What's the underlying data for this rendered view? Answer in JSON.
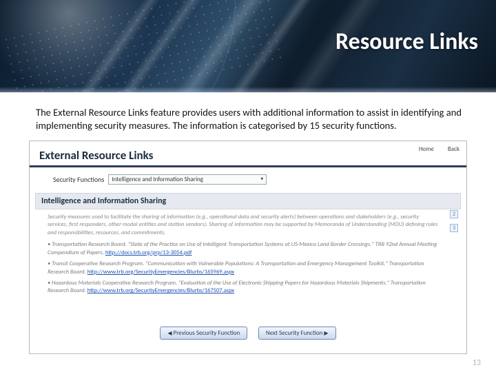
{
  "slide": {
    "title": "Resource Links",
    "intro": "The External Resource Links feature provides users with additional information to assist in identifying and implementing security measures.  The information is categorised by 15 security functions.",
    "pageNumber": "13"
  },
  "topnav": {
    "home": "Home",
    "back": "Back"
  },
  "panel": {
    "heading": "External Resource Links",
    "filterLabel": "Security Functions",
    "dropdownValue": "Intelligence and Information Sharing",
    "subheading": "Intelligence and Information Sharing",
    "descItalic": "Security measures used to facilitate the sharing of information (e.g., operational data and security alerts) between operations and stakeholders (e.g., security services, first responders, other modal entities and station vendors). Sharing of information may be supported by Memoranda of Understanding (MOU) defining roles and responsibilities, resources, and commitments.",
    "items": [
      {
        "text": "• Transportation Research Board. \"State of the Practice on Use of Intelligent Transportation Systems at US-Mexico Land Border Crossings.\" TRB 92nd Annual Meeting Compendium of Papers. ",
        "link": "http://docs.trb.org/prp/13-3054.pdf"
      },
      {
        "text": "• Transit Cooperative Research Program. \"Communication with Vulnerable Populations: A Transportation and Emergency Management Toolkit.\" Transportation Research Board. ",
        "link": "http://www.trb.org/SecurityEmergencies/Blurbs/165969.aspx"
      },
      {
        "text": "• Hazardous Materials Cooperative Research Program. \"Evaluation of the Use of Electronic Shipping Papers for Hazardous Materials Shipments.\" Transportation Research Board. ",
        "link": "http://www.trb.org/SecurityEmergencies/Blurbs/167507.aspx"
      }
    ],
    "sideTop": "2",
    "sideBottom": "3",
    "prevBtn": "Previous Security Function",
    "nextBtn": "Next Security Function"
  }
}
